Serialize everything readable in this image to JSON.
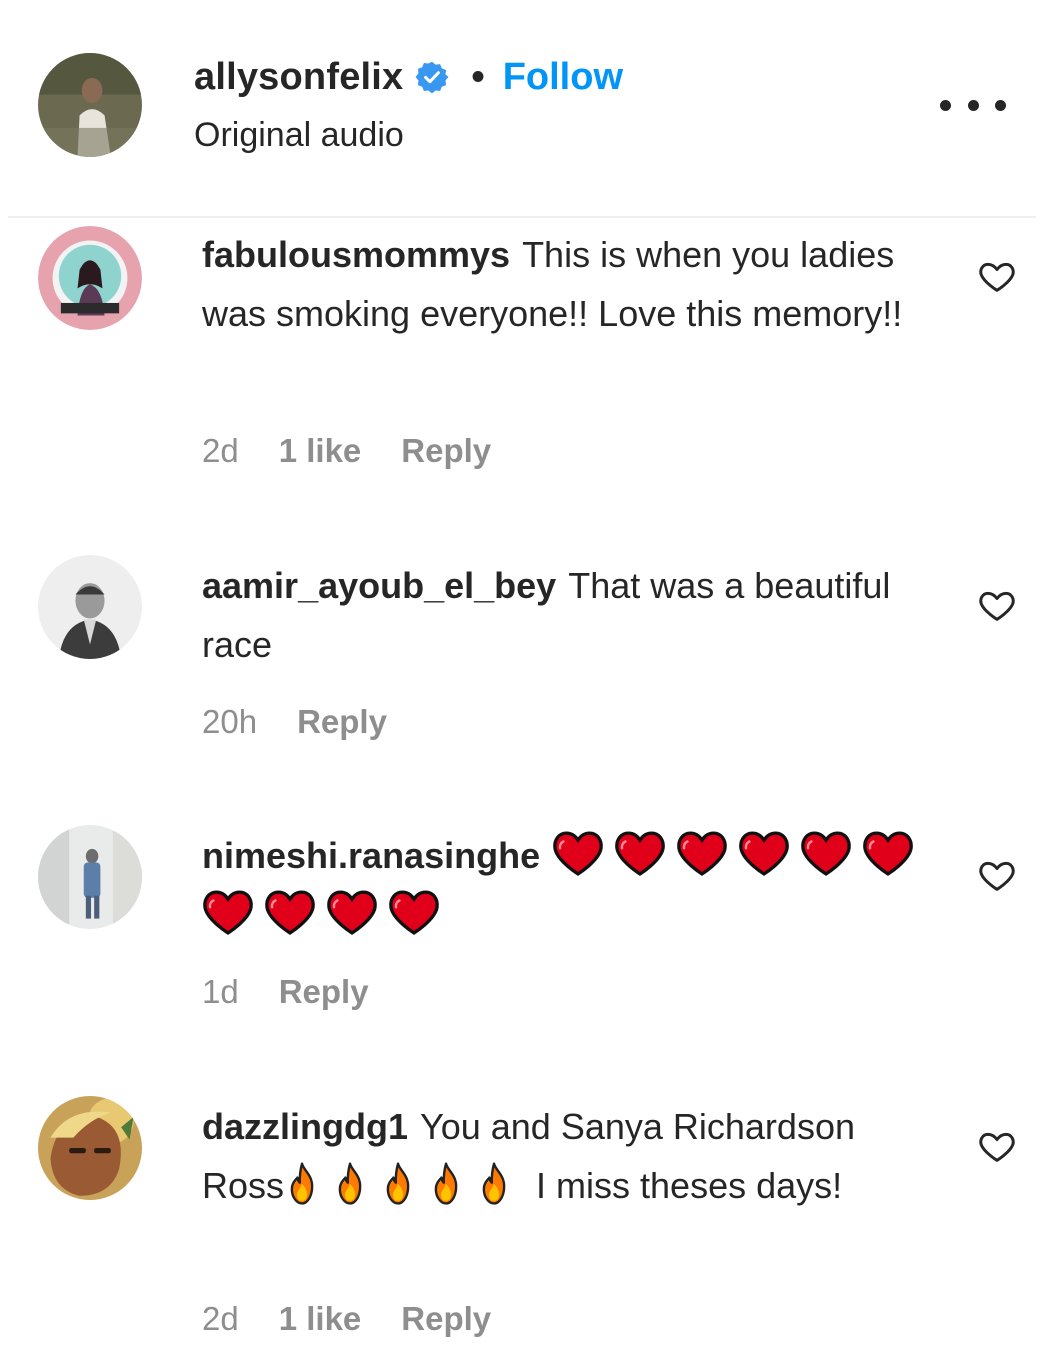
{
  "post_owner": {
    "username": "allysonfelix",
    "separator": "•",
    "follow_label": "Follow",
    "subtitle": "Original audio",
    "verified_icon": "verified-badge-icon",
    "more_icon": "more-options-icon"
  },
  "colors": {
    "text": "#262626",
    "secondary": "#8e8e8e",
    "follow_blue": "#0095f6",
    "heart_emoji": "#e0001a",
    "fire_emoji": "#ff7a00"
  },
  "comments": [
    {
      "username": "fabulousmommys",
      "text": "This is when you ladies was smoking everyone!! Love this memory!!",
      "time": "2d",
      "likes": "1 like",
      "reply_label": "Reply"
    },
    {
      "username": "aamir_ayoub_el_bey",
      "text": "That was a beautiful race",
      "time": "20h",
      "reply_label": "Reply"
    },
    {
      "username": "nimeshi.ranasinghe",
      "text": "",
      "emojis": [
        "❤️",
        "❤️",
        "❤️",
        "❤️",
        "❤️",
        "❤️",
        "❤️",
        "❤️",
        "❤️",
        "❤️"
      ],
      "time": "1d",
      "reply_label": "Reply"
    },
    {
      "username": "dazzlingdg1",
      "text_before": "You and Sanya Richardson Ross",
      "emojis": [
        "🔥",
        "🔥",
        "🔥",
        "🔥",
        "🔥"
      ],
      "text_after": "I miss theses days!",
      "time": "2d",
      "likes": "1 like",
      "reply_label": "Reply"
    }
  ]
}
